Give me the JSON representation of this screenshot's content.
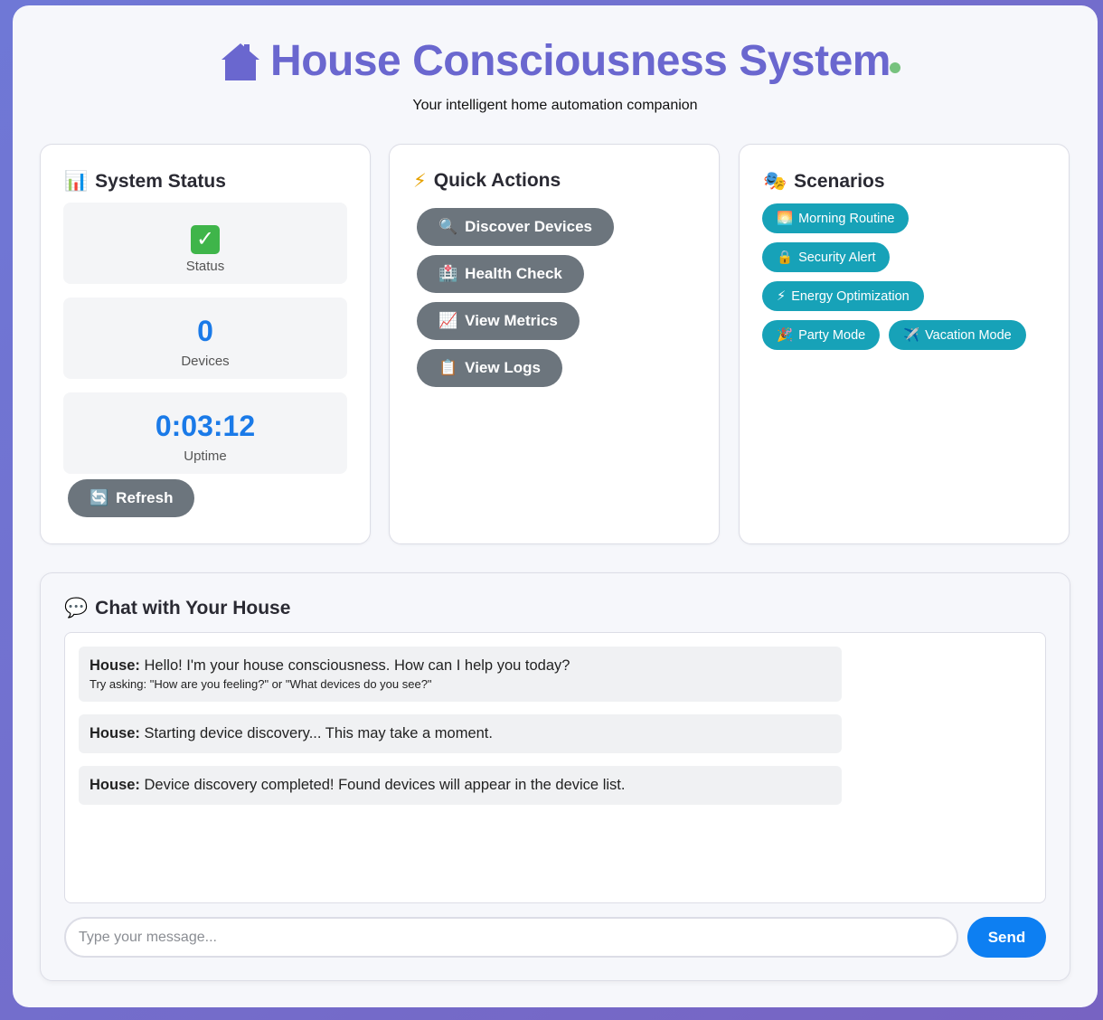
{
  "header": {
    "house_icon": "house-icon",
    "title": "House Consciousness System",
    "subtitle": "Your intelligent home automation companion",
    "status_dot_color": "#77c27e"
  },
  "system_status": {
    "icon": "📊",
    "title": "System Status",
    "status": {
      "icon": "✓",
      "label": "Status"
    },
    "devices": {
      "value": "0",
      "label": "Devices"
    },
    "uptime": {
      "value": "0:03:12",
      "label": "Uptime"
    },
    "refresh": {
      "icon": "🔄",
      "label": "Refresh"
    }
  },
  "quick_actions": {
    "icon": "⚡",
    "title": "Quick Actions",
    "buttons": [
      {
        "icon": "🔍",
        "label": "Discover Devices"
      },
      {
        "icon": "🏥",
        "label": "Health Check"
      },
      {
        "icon": "📈",
        "label": "View Metrics"
      },
      {
        "icon": "📋",
        "label": "View Logs"
      }
    ]
  },
  "scenarios": {
    "icon": "🎭",
    "title": "Scenarios",
    "buttons": [
      {
        "icon": "🌅",
        "label": "Morning Routine"
      },
      {
        "icon": "🔒",
        "label": "Security Alert"
      },
      {
        "icon": "⚡",
        "label": "Energy Optimization"
      },
      {
        "icon": "🎉",
        "label": "Party Mode"
      },
      {
        "icon": "✈️",
        "label": "Vacation Mode"
      }
    ]
  },
  "chat": {
    "icon": "💬",
    "title": "Chat with Your House",
    "messages": [
      {
        "sender": "House:",
        "text": "Hello! I'm your house consciousness. How can I help you today?",
        "hint": "Try asking: \"How are you feeling?\" or \"What devices do you see?\""
      },
      {
        "sender": "House:",
        "text": "Starting device discovery... This may take a moment."
      },
      {
        "sender": "House:",
        "text": "Device discovery completed! Found devices will appear in the device list."
      }
    ],
    "input_placeholder": "Type your message...",
    "input_value": "",
    "send_label": "Send"
  },
  "colors": {
    "accent": "#6a67cf",
    "primary_blue": "#0d7ff2",
    "gray_button": "#6c757d",
    "teal_button": "#17a2b8"
  }
}
